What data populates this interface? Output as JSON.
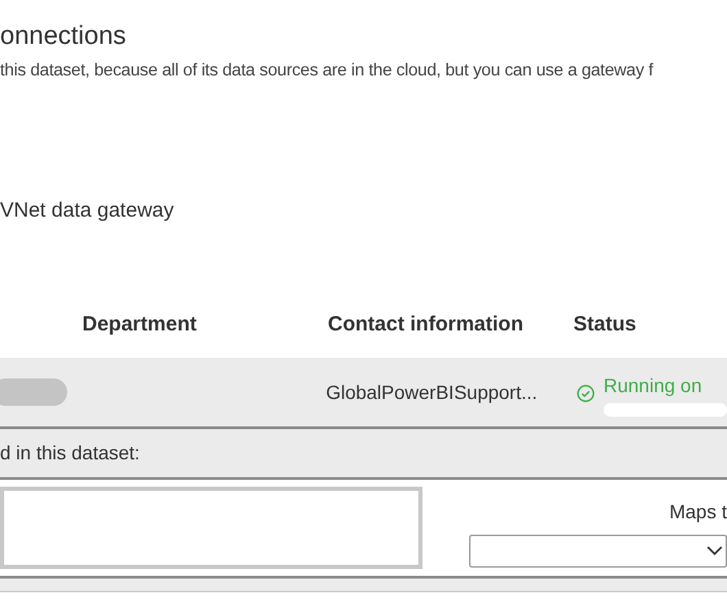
{
  "heading": "onnections",
  "description": "this dataset, because all of its data sources are in the cloud, but you can use a gateway f",
  "gateway_option": "VNet data gateway",
  "table": {
    "columns": [
      "Department",
      "Contact information",
      "Status"
    ],
    "rows": [
      {
        "contact": "GlobalPowerBISupport...",
        "status": "Running on",
        "kind": "ok"
      }
    ]
  },
  "sources_label": "d in this dataset:",
  "maps_to_label": "Maps t"
}
